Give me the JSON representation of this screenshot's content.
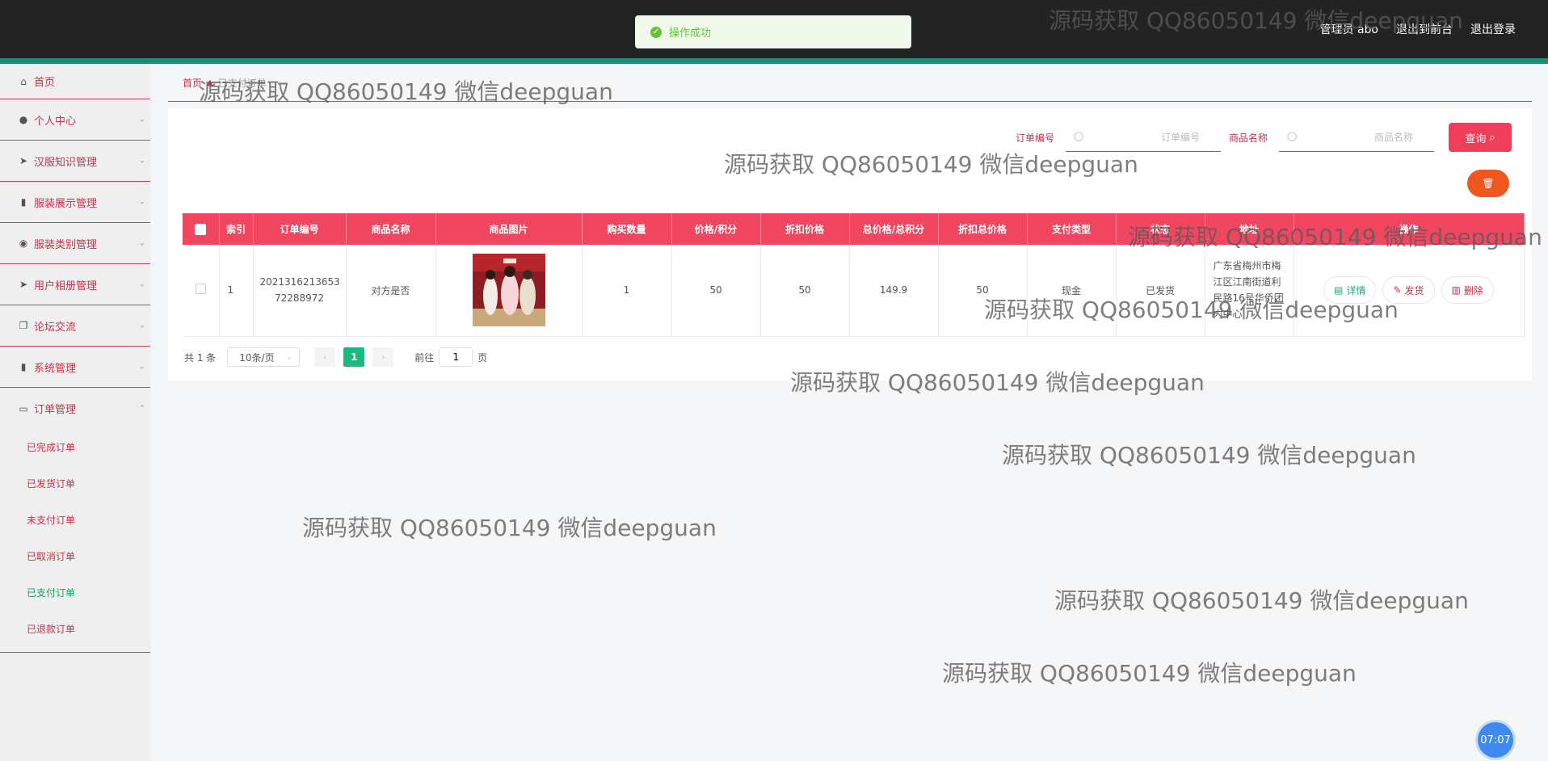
{
  "topbar": {
    "admin_label": "管理员 abo",
    "to_frontend": "退出到前台",
    "logout": "退出登录"
  },
  "toast": {
    "message": "操作成功"
  },
  "sidebar": {
    "items": [
      {
        "label": "首页",
        "icon": "home-icon"
      },
      {
        "label": "个人中心",
        "icon": "user-icon"
      },
      {
        "label": "汉服知识管理",
        "icon": "send-icon"
      },
      {
        "label": "服装展示管理",
        "icon": "chart-icon"
      },
      {
        "label": "服装类别管理",
        "icon": "location-icon"
      },
      {
        "label": "用户相册管理",
        "icon": "send-icon"
      },
      {
        "label": "论坛交流",
        "icon": "copy-icon"
      },
      {
        "label": "系统管理",
        "icon": "chart-icon"
      },
      {
        "label": "订单管理",
        "icon": "order-icon"
      }
    ],
    "order_submenu": [
      {
        "label": "已完成订单"
      },
      {
        "label": "已发货订单"
      },
      {
        "label": "未支付订单"
      },
      {
        "label": "已取消订单"
      },
      {
        "label": "已支付订单",
        "active": true
      },
      {
        "label": "已退款订单"
      }
    ]
  },
  "breadcrumb": {
    "home": "首页",
    "current": "已支付订单"
  },
  "search": {
    "order_no_label": "订单编号",
    "order_no_placeholder": "订单编号",
    "product_name_label": "商品名称",
    "product_name_placeholder": "商品名称",
    "query_button": "查询"
  },
  "table": {
    "headers": [
      "索引",
      "订单编号",
      "商品名称",
      "商品图片",
      "购买数量",
      "价格/积分",
      "折扣价格",
      "总价格/总积分",
      "折扣总价格",
      "支付类型",
      "状态",
      "地址",
      "操作"
    ],
    "rows": [
      {
        "index": "1",
        "order_no": "2021316213653 72288972",
        "product_name": "对方是否",
        "quantity": "1",
        "price": "50",
        "discount_price": "50",
        "total_price": "149.9",
        "discount_total": "50",
        "pay_type": "现金",
        "status": "已发货",
        "address": "广东省梅州市梅江区江南街道利民路16号华侨团内中心"
      }
    ],
    "actions": {
      "detail": "详情",
      "ship": "发货",
      "delete": "删除"
    }
  },
  "pagination": {
    "total": "共 1 条",
    "page_size": "10条/页",
    "current_page": "1",
    "goto_label": "前往",
    "goto_value": "1",
    "page_suffix": "页"
  },
  "watermark": {
    "text": "源码获取 QQ86050149 微信deepguan"
  },
  "clock": {
    "time": "07:07"
  },
  "colors": {
    "accent_red": "#f04660",
    "accent_teal": "#1f8a78",
    "success_green": "#67c23a",
    "page_active": "#1fb87f"
  }
}
